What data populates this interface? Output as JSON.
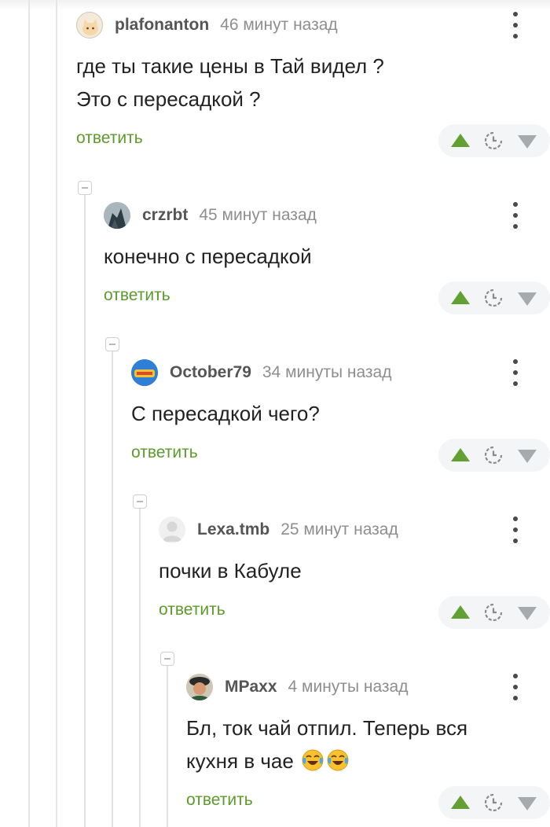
{
  "comments": [
    {
      "username": "plafonanton",
      "time": "46 минут назад",
      "lines": [
        "где ты такие цены в Тай видел ?",
        "Это с пересадкой ?"
      ],
      "reply_label": "ответить",
      "avatar_icon": "cat-avatar"
    },
    {
      "username": "crzrbt",
      "time": "45 минут назад",
      "lines": [
        "конечно с пересадкой"
      ],
      "reply_label": "ответить",
      "avatar_icon": "knight-avatar"
    },
    {
      "username": "October79",
      "time": "34 минуты назад",
      "lines": [
        "С пересадкой чего?"
      ],
      "reply_label": "ответить",
      "avatar_icon": "badge-avatar"
    },
    {
      "username": "Lexa.tmb",
      "time": "25 минут назад",
      "lines": [
        "почки в Кабуле"
      ],
      "reply_label": "ответить",
      "avatar_icon": "default-user-avatar"
    },
    {
      "username": "MPaxx",
      "time": "4 минуты назад",
      "lines": [
        "Бл, ток чай отпил. Теперь вся",
        "кухня в чае"
      ],
      "trailing_emoji": [
        "face-with-tears-of-joy",
        "face-with-tears-of-joy"
      ],
      "reply_label": "ответить",
      "avatar_icon": "photo-avatar"
    }
  ],
  "vote_icons": [
    "upvote-arrow",
    "save-clock-icon",
    "downvote-arrow"
  ],
  "colors": {
    "reply_green": "#5c9a2c",
    "upvote_green": "#63a032",
    "downvote_gray": "#a7aaad",
    "vote_bg": "#f3f5f6",
    "username": "#555555",
    "time": "#8e8e8e"
  }
}
